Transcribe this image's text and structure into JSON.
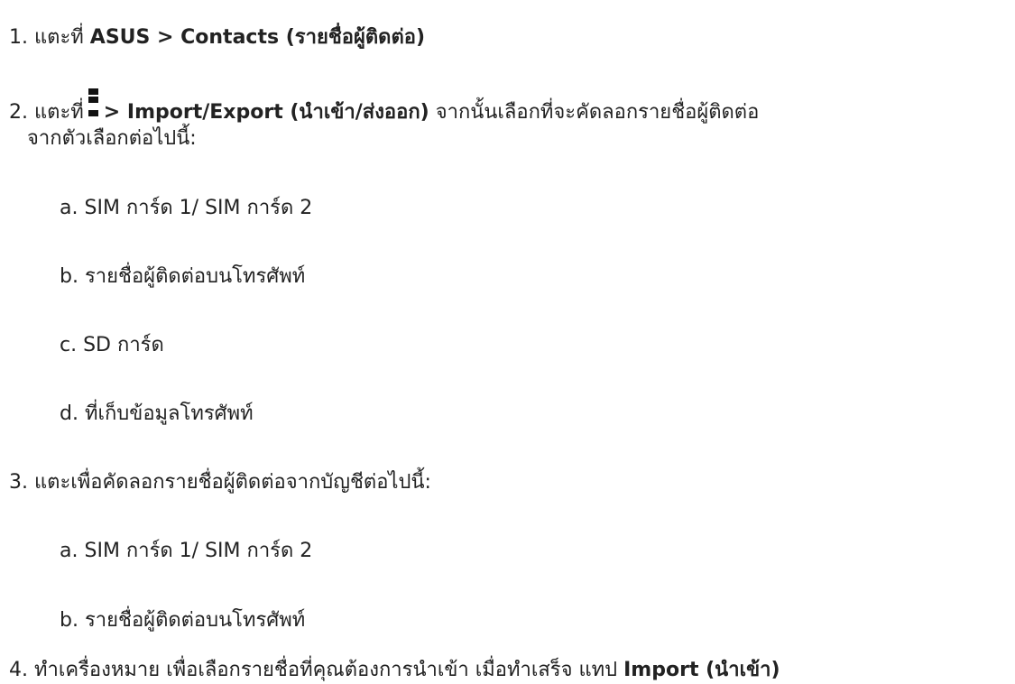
{
  "steps": [
    {
      "num": "1.",
      "pre": "แตะที่",
      "b1": "ASUS > Contacts (รายชื่อผู้ติดต่อ)"
    },
    {
      "num": "2.",
      "pre": "แตะที่",
      "icon": "overflow-menu-icon",
      "b1": "> Import/Export (นำเข้า/ส่งออก)",
      "post": "จากนั้นเลือกที่จะคัดลอกรายชื่อผู้ติดต่อ",
      "cont": "จากตัวเลือกต่อไปนี้:",
      "subs": [
        {
          "letter": "a.",
          "text": "SIM การ์ด 1/ SIM การ์ด 2"
        },
        {
          "letter": "b.",
          "text": "รายชื่อผู้ติดต่อบนโทรศัพท์"
        },
        {
          "letter": "c.",
          "text": "SD การ์ด"
        },
        {
          "letter": "d.",
          "text": "ที่เก็บข้อมูลโทรศัพท์"
        }
      ]
    },
    {
      "num": "3.",
      "pre": "แตะเพื่อคัดลอกรายชื่อผู้ติดต่อจากบัญชีต่อไปนี้:",
      "subs": [
        {
          "letter": "a.",
          "text": "SIM การ์ด 1/ SIM การ์ด 2"
        },
        {
          "letter": "b.",
          "text": "รายชื่อผู้ติดต่อบนโทรศัพท์"
        }
      ]
    },
    {
      "num": "4.",
      "pre": "ทำเครื่องหมาย เพื่อเลือกรายชื่อที่คุณต้องการนำเข้า เมื่อทำเสร็จ แทป",
      "b1": "Import (นำเข้า)"
    }
  ]
}
